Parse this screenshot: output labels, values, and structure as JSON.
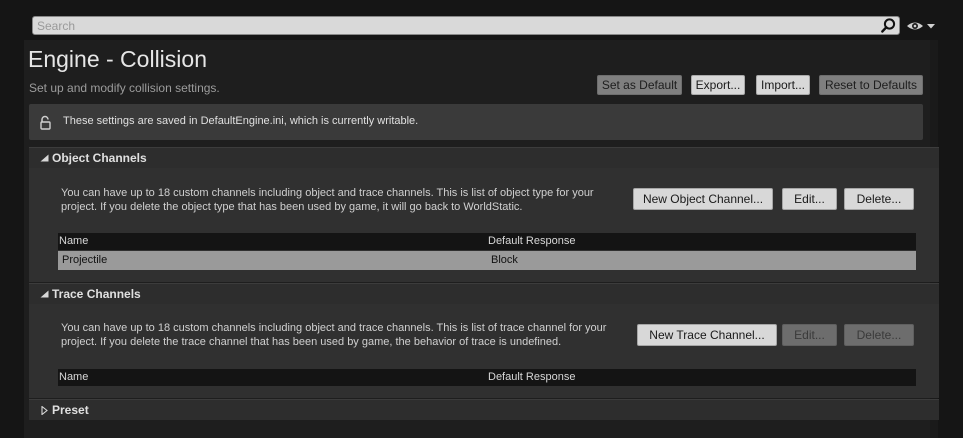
{
  "search": {
    "placeholder": "Search"
  },
  "header": {
    "title": "Engine - Collision",
    "subtitle": "Set up and modify collision settings.",
    "buttons": {
      "set_default": "Set as Default",
      "export": "Export...",
      "import": "Import...",
      "reset": "Reset to Defaults"
    }
  },
  "notice": {
    "text": "These settings are saved in DefaultEngine.ini, which is currently writable."
  },
  "object_channels": {
    "title": "Object Channels",
    "expanded": true,
    "description": "You can have up to 18 custom channels including object and trace channels. This is list of object type for your project. If you delete the object type that has been used by game, it will go back to WorldStatic.",
    "buttons": {
      "new": "New Object Channel...",
      "edit": "Edit...",
      "delete": "Delete..."
    },
    "columns": [
      "Name",
      "Default Response"
    ],
    "rows": [
      {
        "name": "Projectile",
        "response": "Block"
      }
    ]
  },
  "trace_channels": {
    "title": "Trace Channels",
    "expanded": true,
    "description": "You can have up to 18 custom channels including object and trace channels. This is list of trace channel for your project. If you delete the trace channel that has been used by game, the behavior of trace is undefined.",
    "buttons": {
      "new": "New Trace Channel...",
      "edit": "Edit...",
      "delete": "Delete..."
    },
    "columns": [
      "Name",
      "Default Response"
    ],
    "rows": []
  },
  "preset": {
    "title": "Preset",
    "expanded": false
  },
  "icons": [
    "search-icon",
    "eye-icon",
    "dropdown-arrow-icon",
    "lock-icon",
    "expand-arrow-icon",
    "collapse-arrow-icon"
  ]
}
